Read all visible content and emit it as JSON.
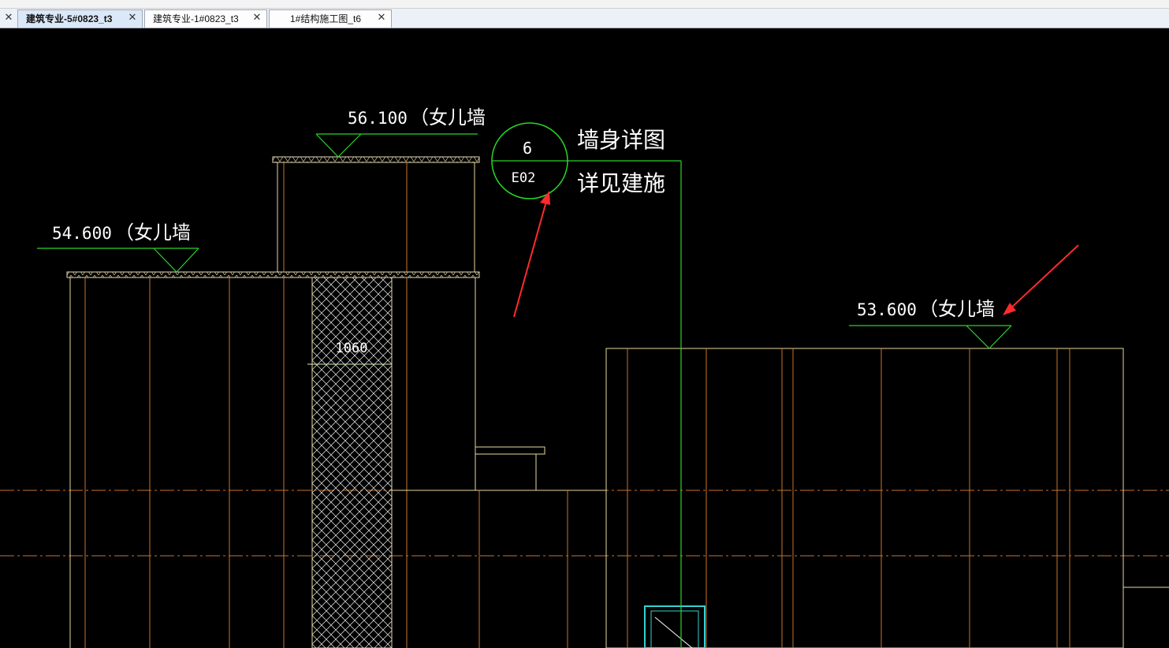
{
  "menubar": {
    "items": [
      "",
      "",
      "",
      "",
      "",
      "",
      "",
      "",
      "",
      "",
      "",
      "",
      "",
      "",
      "",
      "",
      "",
      "",
      "",
      "",
      "",
      ""
    ]
  },
  "tabs": [
    {
      "label": "建筑专业-5#0823_t3",
      "active": true
    },
    {
      "label": "建筑专业-1#0823_t3",
      "active": false
    },
    {
      "label": "1#结构施工图_t6",
      "active": false
    }
  ],
  "icons": {
    "close": "close-icon"
  },
  "drawing": {
    "elevation_561": "56.100",
    "elevation_546": "54.600",
    "elevation_536": "53.600",
    "parapet_label": "（女儿墙",
    "detail_number": "6",
    "detail_sheet": "E02",
    "detail_title": "墙身详图",
    "detail_note": "详见建施",
    "dimension_1060": "1060"
  },
  "colors": {
    "background": "#000000",
    "line_yellow": "#e8d8a0",
    "line_orange": "#c8742a",
    "line_green": "#2bd42b",
    "hatch_white": "#ffffff",
    "arrow_red": "#ff2b2b",
    "cyan": "#34d2d2"
  }
}
